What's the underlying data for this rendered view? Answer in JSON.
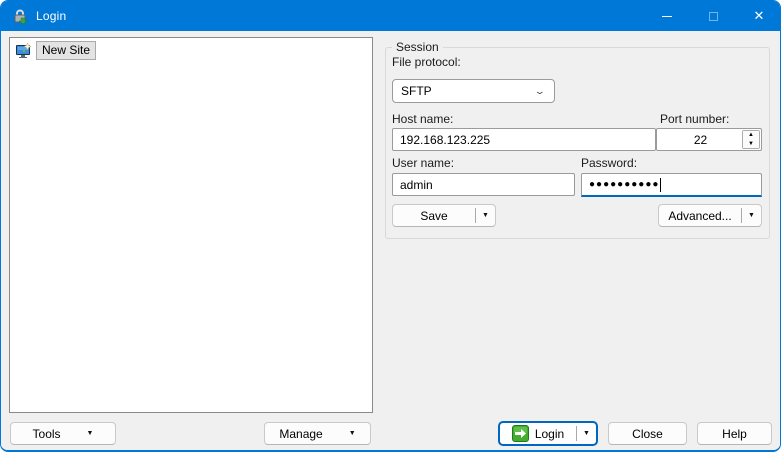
{
  "titlebar": {
    "title": "Login",
    "close_glyph": "✕"
  },
  "site_list": {
    "items": [
      {
        "label": "New Site"
      }
    ]
  },
  "session": {
    "group_label": "Session",
    "file_protocol": {
      "label": "File protocol:",
      "value": "SFTP"
    },
    "host": {
      "label": "Host name:",
      "value": "192.168.123.225"
    },
    "port": {
      "label": "Port number:",
      "value": "22"
    },
    "user": {
      "label": "User name:",
      "value": "admin"
    },
    "password": {
      "label": "Password:",
      "masked_value": "●●●●●●●●●●"
    },
    "save_button": "Save",
    "advanced_button": "Advanced..."
  },
  "footer": {
    "tools": "Tools",
    "manage": "Manage",
    "login": "Login",
    "close": "Close",
    "help": "Help"
  },
  "glyphs": {
    "dropdown_arrow": "▼",
    "combo_chevron": "⌄",
    "spin_up": "▲",
    "spin_down": "▼"
  },
  "colors": {
    "accent_titlebar": "#0078d7",
    "focus_underline": "#0067c0",
    "dialog_bg": "#f0f0f0",
    "login_icon_green": "#44ad2f"
  }
}
